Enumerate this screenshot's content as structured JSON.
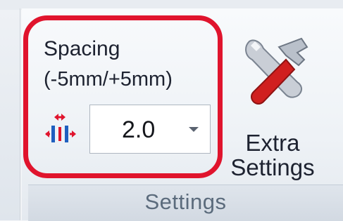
{
  "spacing": {
    "title": "Spacing",
    "range": "(-5mm/+5mm)",
    "value": "2.0",
    "icon": "spacing-arrows-icon"
  },
  "extra_settings": {
    "line1": "Extra",
    "line2": "Settings",
    "icon": "wrench-hammer-icon"
  },
  "group": {
    "label": "Settings"
  },
  "colors": {
    "highlight": "#e0142d",
    "accent_arrow": "#e0142d",
    "accent_bar": "#1f5fbf"
  }
}
